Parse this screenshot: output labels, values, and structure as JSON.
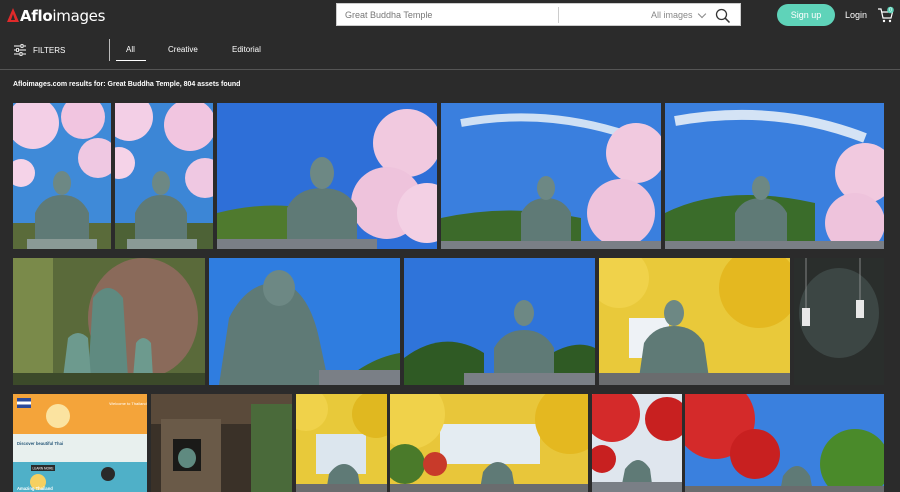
{
  "header": {
    "logo_main": "Aflo",
    "logo_sub": "images",
    "search_value": "Great Buddha Temple",
    "search_scope": "All images",
    "signup_label": "Sign up",
    "login_label": "Login",
    "cart_count": "0"
  },
  "filterbar": {
    "filters_label": "FILTERS",
    "tabs": [
      {
        "label": "All",
        "active": true
      },
      {
        "label": "Creative",
        "active": false
      },
      {
        "label": "Editorial",
        "active": false
      }
    ]
  },
  "results": {
    "text": "Afloimages.com results for: Great Buddha Temple, 804 assets found"
  },
  "thumbnail_panels": {
    "ad_title_1": "Welcome to Thailand",
    "ad_title_2": "Discover beautiful Thai",
    "ad_title_3": "Amazing Thailand",
    "ad_button": "LEARN MORE"
  },
  "colors": {
    "background": "#2b2b2b",
    "accent": "#5fd3b9",
    "logo_red": "#e02a2a"
  }
}
